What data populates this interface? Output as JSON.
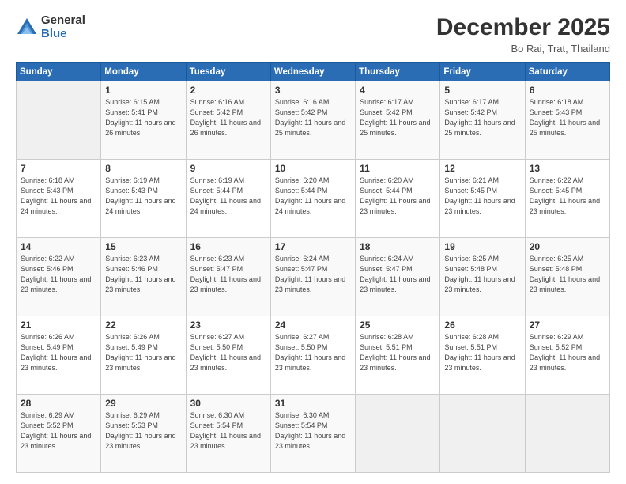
{
  "logo": {
    "general": "General",
    "blue": "Blue"
  },
  "header": {
    "month": "December 2025",
    "location": "Bo Rai, Trat, Thailand"
  },
  "days_of_week": [
    "Sunday",
    "Monday",
    "Tuesday",
    "Wednesday",
    "Thursday",
    "Friday",
    "Saturday"
  ],
  "weeks": [
    [
      {
        "day": "",
        "info": ""
      },
      {
        "day": "1",
        "info": "Sunrise: 6:15 AM\nSunset: 5:41 PM\nDaylight: 11 hours and 26 minutes."
      },
      {
        "day": "2",
        "info": "Sunrise: 6:16 AM\nSunset: 5:42 PM\nDaylight: 11 hours and 26 minutes."
      },
      {
        "day": "3",
        "info": "Sunrise: 6:16 AM\nSunset: 5:42 PM\nDaylight: 11 hours and 25 minutes."
      },
      {
        "day": "4",
        "info": "Sunrise: 6:17 AM\nSunset: 5:42 PM\nDaylight: 11 hours and 25 minutes."
      },
      {
        "day": "5",
        "info": "Sunrise: 6:17 AM\nSunset: 5:42 PM\nDaylight: 11 hours and 25 minutes."
      },
      {
        "day": "6",
        "info": "Sunrise: 6:18 AM\nSunset: 5:43 PM\nDaylight: 11 hours and 25 minutes."
      }
    ],
    [
      {
        "day": "7",
        "info": "Sunrise: 6:18 AM\nSunset: 5:43 PM\nDaylight: 11 hours and 24 minutes."
      },
      {
        "day": "8",
        "info": "Sunrise: 6:19 AM\nSunset: 5:43 PM\nDaylight: 11 hours and 24 minutes."
      },
      {
        "day": "9",
        "info": "Sunrise: 6:19 AM\nSunset: 5:44 PM\nDaylight: 11 hours and 24 minutes."
      },
      {
        "day": "10",
        "info": "Sunrise: 6:20 AM\nSunset: 5:44 PM\nDaylight: 11 hours and 24 minutes."
      },
      {
        "day": "11",
        "info": "Sunrise: 6:20 AM\nSunset: 5:44 PM\nDaylight: 11 hours and 23 minutes."
      },
      {
        "day": "12",
        "info": "Sunrise: 6:21 AM\nSunset: 5:45 PM\nDaylight: 11 hours and 23 minutes."
      },
      {
        "day": "13",
        "info": "Sunrise: 6:22 AM\nSunset: 5:45 PM\nDaylight: 11 hours and 23 minutes."
      }
    ],
    [
      {
        "day": "14",
        "info": "Sunrise: 6:22 AM\nSunset: 5:46 PM\nDaylight: 11 hours and 23 minutes."
      },
      {
        "day": "15",
        "info": "Sunrise: 6:23 AM\nSunset: 5:46 PM\nDaylight: 11 hours and 23 minutes."
      },
      {
        "day": "16",
        "info": "Sunrise: 6:23 AM\nSunset: 5:47 PM\nDaylight: 11 hours and 23 minutes."
      },
      {
        "day": "17",
        "info": "Sunrise: 6:24 AM\nSunset: 5:47 PM\nDaylight: 11 hours and 23 minutes."
      },
      {
        "day": "18",
        "info": "Sunrise: 6:24 AM\nSunset: 5:47 PM\nDaylight: 11 hours and 23 minutes."
      },
      {
        "day": "19",
        "info": "Sunrise: 6:25 AM\nSunset: 5:48 PM\nDaylight: 11 hours and 23 minutes."
      },
      {
        "day": "20",
        "info": "Sunrise: 6:25 AM\nSunset: 5:48 PM\nDaylight: 11 hours and 23 minutes."
      }
    ],
    [
      {
        "day": "21",
        "info": "Sunrise: 6:26 AM\nSunset: 5:49 PM\nDaylight: 11 hours and 23 minutes."
      },
      {
        "day": "22",
        "info": "Sunrise: 6:26 AM\nSunset: 5:49 PM\nDaylight: 11 hours and 23 minutes."
      },
      {
        "day": "23",
        "info": "Sunrise: 6:27 AM\nSunset: 5:50 PM\nDaylight: 11 hours and 23 minutes."
      },
      {
        "day": "24",
        "info": "Sunrise: 6:27 AM\nSunset: 5:50 PM\nDaylight: 11 hours and 23 minutes."
      },
      {
        "day": "25",
        "info": "Sunrise: 6:28 AM\nSunset: 5:51 PM\nDaylight: 11 hours and 23 minutes."
      },
      {
        "day": "26",
        "info": "Sunrise: 6:28 AM\nSunset: 5:51 PM\nDaylight: 11 hours and 23 minutes."
      },
      {
        "day": "27",
        "info": "Sunrise: 6:29 AM\nSunset: 5:52 PM\nDaylight: 11 hours and 23 minutes."
      }
    ],
    [
      {
        "day": "28",
        "info": "Sunrise: 6:29 AM\nSunset: 5:52 PM\nDaylight: 11 hours and 23 minutes."
      },
      {
        "day": "29",
        "info": "Sunrise: 6:29 AM\nSunset: 5:53 PM\nDaylight: 11 hours and 23 minutes."
      },
      {
        "day": "30",
        "info": "Sunrise: 6:30 AM\nSunset: 5:54 PM\nDaylight: 11 hours and 23 minutes."
      },
      {
        "day": "31",
        "info": "Sunrise: 6:30 AM\nSunset: 5:54 PM\nDaylight: 11 hours and 23 minutes."
      },
      {
        "day": "",
        "info": ""
      },
      {
        "day": "",
        "info": ""
      },
      {
        "day": "",
        "info": ""
      }
    ]
  ]
}
